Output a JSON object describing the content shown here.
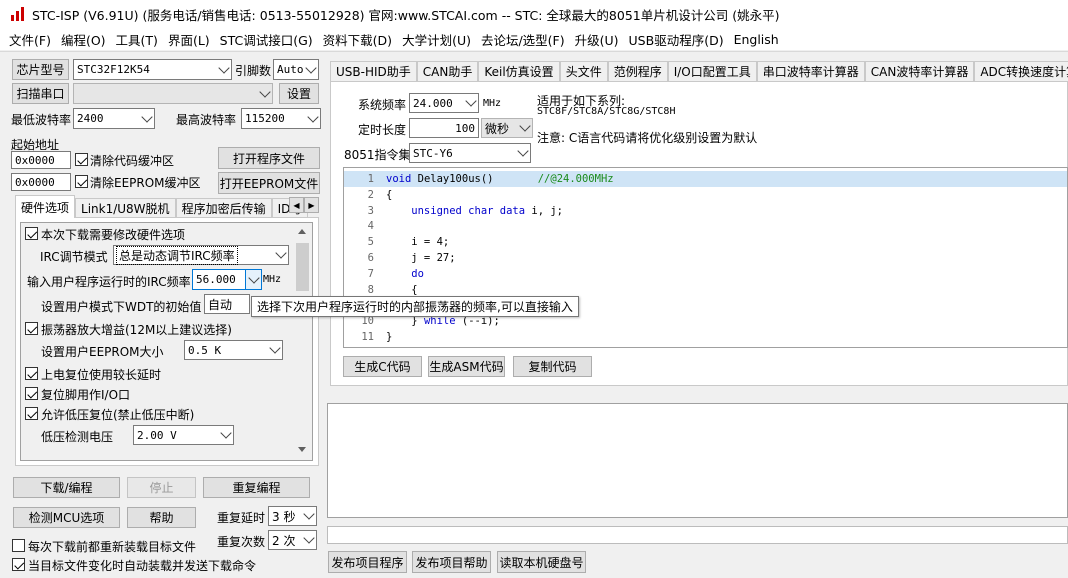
{
  "window": {
    "title": "STC-ISP (V6.91U) (服务电话/销售电话: 0513-55012928) 官网:www.STCAI.com  -- STC: 全球最大的8051单片机设计公司 (姚永平)"
  },
  "menu": [
    "文件(F)",
    "编程(O)",
    "工具(T)",
    "界面(L)",
    "STC调试接口(G)",
    "资料下载(D)",
    "大学计划(U)",
    "去论坛/选型(F)",
    "升级(U)",
    "USB驱动程序(D)",
    "English"
  ],
  "left": {
    "chip_label": "芯片型号",
    "chip_value": "STC32F12K54",
    "pin_label": "引脚数",
    "pin_value": "Auto",
    "scan_button": "扫描串口",
    "settings_button": "设置",
    "min_baud_label": "最低波特率",
    "min_baud_value": "2400",
    "max_baud_label": "最高波特率",
    "max_baud_value": "115200",
    "start_addr_label": "起始地址",
    "addr1": "0x0000",
    "clear_code_label": "清除代码缓冲区",
    "open_prog_button": "打开程序文件",
    "addr2": "0x0000",
    "clear_eeprom_label": "清除EEPROM缓冲区",
    "open_eeprom_button": "打开EEPROM文件",
    "tabs": [
      "硬件选项",
      "Link1/U8W脱机",
      "程序加密后传输",
      "ID号"
    ],
    "hw": {
      "modify_hw": "本次下载需要修改硬件选项",
      "irc_mode_label": "IRC调节模式",
      "irc_mode_value": "总是动态调节IRC频率",
      "irc_freq_label": "输入用户程序运行时的IRC频率",
      "irc_freq_value": "56.000",
      "irc_freq_unit": "MHz",
      "wdt_label": "设置用户模式下WDT的初始值",
      "wdt_value": "自动",
      "osc_gain": "振荡器放大增益(12M以上建议选择)",
      "eeprom_size_label": "设置用户EEPROM大小",
      "eeprom_size_value": "0.5 K",
      "power_delay": "上电复位使用较长延时",
      "reset_pin": "复位脚用作I/O口",
      "lvd_reset": "允许低压复位(禁止低压中断)",
      "lvd_voltage_label": "低压检测电压",
      "lvd_voltage_value": "2.00 V"
    },
    "download_button": "下载/编程",
    "stop_button": "停止",
    "reprogram_button": "重复编程",
    "check_mcu_button": "检测MCU选项",
    "help_button": "帮助",
    "repeat_delay_label": "重复延时",
    "repeat_delay_value": "3 秒",
    "repeat_count_label": "重复次数",
    "repeat_count_value": "2 次",
    "reload_label": "每次下载前都重新装载目标文件",
    "auto_load_label": "当目标文件变化时自动装载并发送下载命令"
  },
  "right": {
    "tabs": [
      "USB-HID助手",
      "CAN助手",
      "Keil仿真设置",
      "头文件",
      "范例程序",
      "I/O口配置工具",
      "串口波特率计算器",
      "CAN波特率计算器",
      "ADC转换速度计算器"
    ],
    "sys_freq_label": "系统频率",
    "sys_freq_value": "24.000",
    "sys_freq_unit": "MHz",
    "delay_label": "定时长度",
    "delay_value": "100",
    "delay_unit": "微秒",
    "isa_label": "8051指令集",
    "isa_value": "STC-Y6",
    "applies_title": "适用于如下系列:",
    "applies_series": "STC8F/STC8A/STC8G/STC8H",
    "note": "注意: C语言代码请将优化级别设置为默认",
    "gen_c_button": "生成C代码",
    "gen_asm_button": "生成ASM代码",
    "copy_button": "复制代码",
    "publish_button": "发布项目程序",
    "publish_help_button": "发布项目帮助",
    "read_disk_button": "读取本机硬盘号"
  },
  "code": [
    {
      "n": "1",
      "parts": [
        [
          "kw",
          "void"
        ],
        [
          "",
          " Delay100us()       "
        ],
        [
          "cm",
          "//@24.000MHz"
        ]
      ]
    },
    {
      "n": "2",
      "parts": [
        [
          "",
          "{"
        ]
      ]
    },
    {
      "n": "3",
      "parts": [
        [
          "kw",
          "    unsigned char data"
        ],
        [
          "",
          " i, j;"
        ]
      ]
    },
    {
      "n": "4",
      "parts": []
    },
    {
      "n": "5",
      "parts": [
        [
          "",
          "    i = 4;"
        ]
      ]
    },
    {
      "n": "6",
      "parts": [
        [
          "",
          "    j = 27;"
        ]
      ]
    },
    {
      "n": "7",
      "parts": [
        [
          "kw",
          "    do"
        ]
      ]
    },
    {
      "n": "8",
      "parts": [
        [
          "",
          "    {"
        ]
      ]
    },
    {
      "n": "9",
      "parts": [
        [
          "",
          ""
        ]
      ]
    },
    {
      "n": "10",
      "parts": [
        [
          "",
          "    } "
        ],
        [
          "kw",
          "while"
        ],
        [
          "",
          " (--i);"
        ]
      ]
    },
    {
      "n": "11",
      "parts": [
        [
          "",
          "}"
        ]
      ]
    }
  ],
  "tooltip": "选择下次用户程序运行时的内部振荡器的频率,可以直接输入",
  "colors": {
    "accent": "#0078d7",
    "highlight_line": "#cfe4f6",
    "keyword": "#0000cc",
    "comment": "#1a8a1a"
  }
}
